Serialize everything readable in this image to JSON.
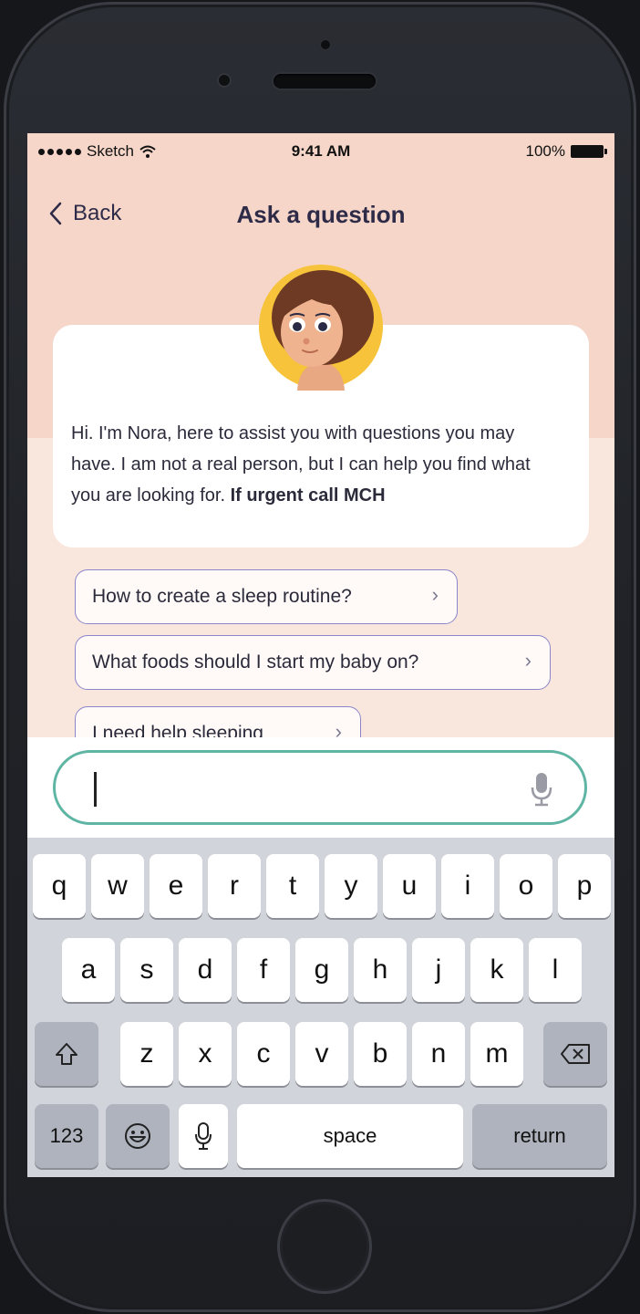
{
  "status_bar": {
    "carrier": "Sketch",
    "time": "9:41 AM",
    "battery": "100%"
  },
  "nav": {
    "back_label": "Back",
    "title": "Ask a question"
  },
  "assistant": {
    "intro": "Hi. I'm Nora, here to assist you with questions you may have. I am not a real person, but I can help you find what you are looking for.",
    "urgent": "If urgent call MCH"
  },
  "suggestions": [
    {
      "label": "How to create a sleep routine?"
    },
    {
      "label": "What foods should I start my baby on?"
    },
    {
      "label": "I need help sleeping"
    }
  ],
  "input": {
    "value": ""
  },
  "keyboard": {
    "row1": [
      "q",
      "w",
      "e",
      "r",
      "t",
      "y",
      "u",
      "i",
      "o",
      "p"
    ],
    "row2": [
      "a",
      "s",
      "d",
      "f",
      "g",
      "h",
      "j",
      "k",
      "l"
    ],
    "row3": [
      "z",
      "x",
      "c",
      "v",
      "b",
      "n",
      "m"
    ],
    "numbers_label": "123",
    "space_label": "space",
    "return_label": "return"
  },
  "colors": {
    "header_bg": "#f5d6c9",
    "content_bg": "#f9e6dd",
    "chip_border": "#8b86c9",
    "input_border": "#5fb5a3",
    "title_text": "#2d2b48"
  }
}
